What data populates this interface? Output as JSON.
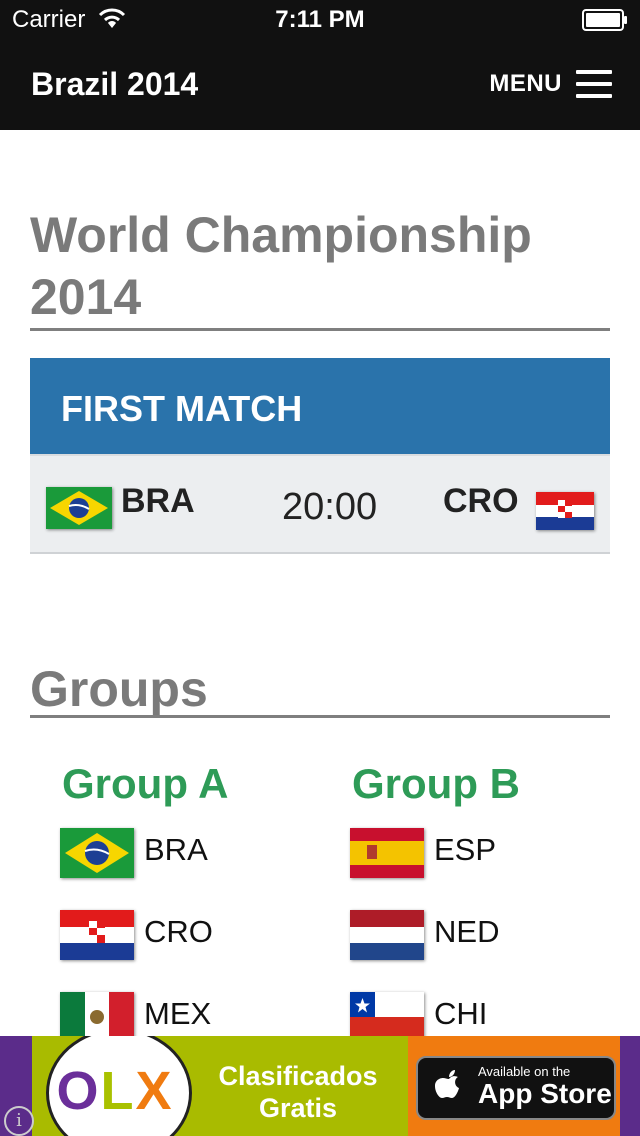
{
  "status_bar": {
    "carrier": "Carrier",
    "time": "7:11 PM"
  },
  "navbar": {
    "brand": "Brazil 2014",
    "menu_label": "MENU"
  },
  "page_title": "World Championship 2014",
  "first_match": {
    "header": "FIRST MATCH",
    "home_team": "BRA",
    "away_team": "CRO",
    "kickoff": "20:00"
  },
  "groups": {
    "title": "Groups",
    "list": [
      {
        "name": "Group A",
        "teams": [
          {
            "code": "BRA",
            "flag": "brazil-flag-icon"
          },
          {
            "code": "CRO",
            "flag": "croatia-flag-icon"
          },
          {
            "code": "MEX",
            "flag": "mexico-flag-icon"
          }
        ]
      },
      {
        "name": "Group B",
        "teams": [
          {
            "code": "ESP",
            "flag": "spain-flag-icon"
          },
          {
            "code": "NED",
            "flag": "netherlands-flag-icon"
          },
          {
            "code": "CHI",
            "flag": "chile-flag-icon"
          }
        ]
      }
    ]
  },
  "ad": {
    "logo": "OLX",
    "promo_line1": "Clasificados",
    "promo_line2": "Gratis",
    "appstore_small": "Available on the",
    "appstore_big": "App Store",
    "info_glyph": "i"
  },
  "colors": {
    "navbar_bg": "#111111",
    "match_header_bg": "#2a73ab",
    "group_title": "#2e9b57",
    "heading_gray": "#7a7a7a"
  }
}
